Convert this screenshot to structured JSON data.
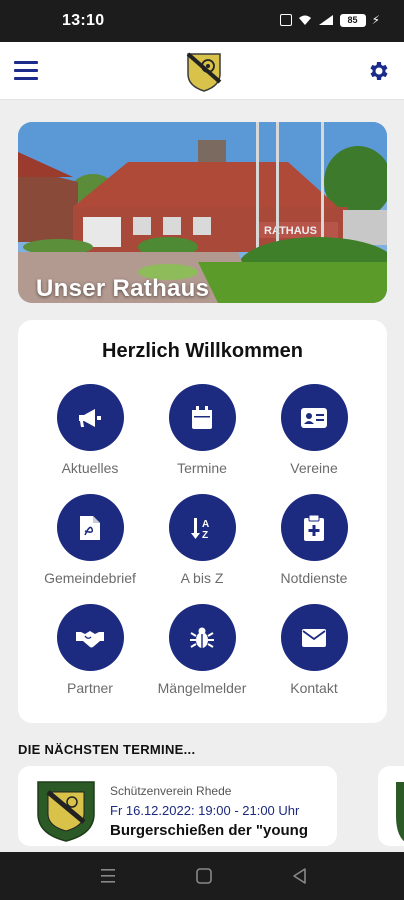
{
  "status_bar": {
    "time": "13:10",
    "battery": "85"
  },
  "app_bar": {
    "menu_icon": "hamburger-menu-icon",
    "logo": "coat-of-arms",
    "settings_icon": "gear-icon",
    "colors": {
      "accent": "#1a2b8c"
    }
  },
  "hero": {
    "title": "Unser Rathaus",
    "building_sign": "RATHAUS"
  },
  "welcome": {
    "title": "Herzlich Willkommen",
    "tiles": [
      {
        "label": "Aktuelles",
        "icon": "megaphone-icon"
      },
      {
        "label": "Termine",
        "icon": "calendar-icon"
      },
      {
        "label": "Vereine",
        "icon": "id-card-icon"
      },
      {
        "label": "Gemeindebrief",
        "icon": "pdf-file-icon"
      },
      {
        "label": "A bis Z",
        "icon": "sort-alpha-icon"
      },
      {
        "label": "Notdienste",
        "icon": "medical-clipboard-icon"
      },
      {
        "label": "Partner",
        "icon": "handshake-icon"
      },
      {
        "label": "Mängelmelder",
        "icon": "bug-icon"
      },
      {
        "label": "Kontakt",
        "icon": "envelope-icon"
      }
    ]
  },
  "events": {
    "section_title": "DIE NÄCHSTEN TERMINE...",
    "items": [
      {
        "organizer": "Schützenverein Rhede",
        "date": "Fr 16.12.2022: 19:00 - 21:00 Uhr",
        "title": "Burgerschießen der \"young",
        "logo_icon": "schuetzenverein-crest-icon"
      }
    ]
  },
  "nav_bar": {
    "recent": "recent-apps-icon",
    "home": "home-icon",
    "back": "back-icon"
  }
}
